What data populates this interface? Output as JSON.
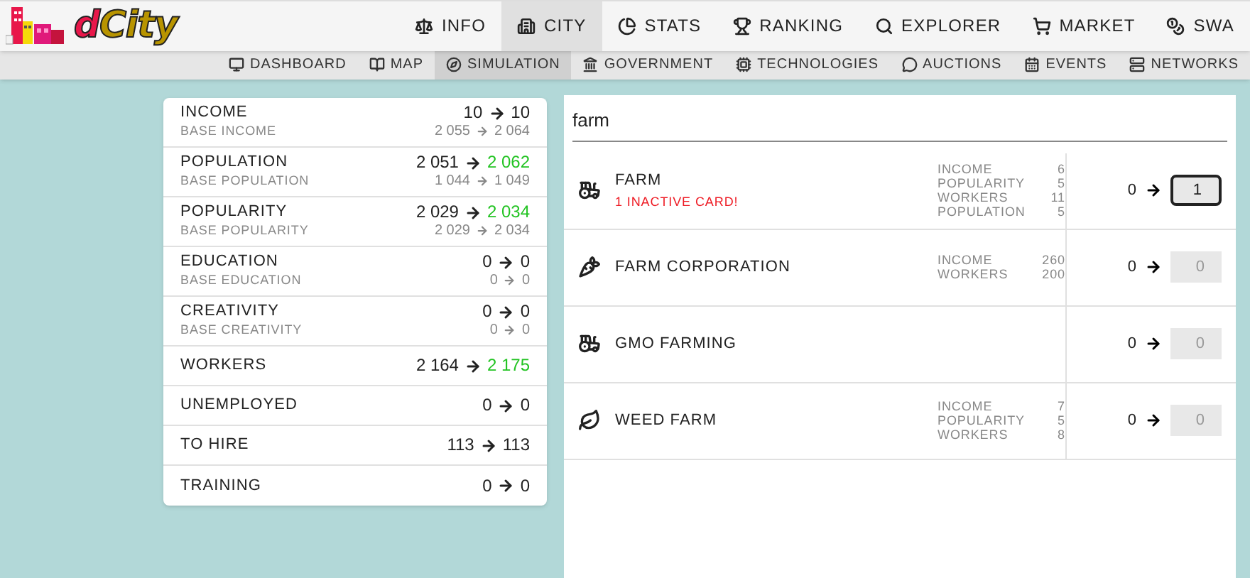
{
  "logo": {
    "prefix": "d",
    "name": "City"
  },
  "nav": [
    {
      "label": "INFO",
      "selected": false
    },
    {
      "label": "CITY",
      "selected": true
    },
    {
      "label": "STATS",
      "selected": false
    },
    {
      "label": "RANKING",
      "selected": false
    },
    {
      "label": "EXPLORER",
      "selected": false
    },
    {
      "label": "MARKET",
      "selected": false
    },
    {
      "label": "SWA",
      "selected": false
    }
  ],
  "subnav": [
    {
      "label": "DASHBOARD",
      "selected": false
    },
    {
      "label": "MAP",
      "selected": false
    },
    {
      "label": "SIMULATION",
      "selected": true
    },
    {
      "label": "GOVERNMENT",
      "selected": false
    },
    {
      "label": "TECHNOLOGIES",
      "selected": false
    },
    {
      "label": "AUCTIONS",
      "selected": false
    },
    {
      "label": "EVENTS",
      "selected": false
    },
    {
      "label": "NETWORKS",
      "selected": false
    }
  ],
  "summary": [
    {
      "label": "INCOME",
      "from": "10",
      "to": "10",
      "up": false,
      "base": {
        "label": "BASE INCOME",
        "from": "2 055",
        "to": "2 064"
      }
    },
    {
      "label": "POPULATION",
      "from": "2 051",
      "to": "2 062",
      "up": true,
      "base": {
        "label": "BASE POPULATION",
        "from": "1 044",
        "to": "1 049"
      }
    },
    {
      "label": "POPULARITY",
      "from": "2 029",
      "to": "2 034",
      "up": true,
      "base": {
        "label": "BASE POPULARITY",
        "from": "2 029",
        "to": "2 034"
      }
    },
    {
      "label": "EDUCATION",
      "from": "0",
      "to": "0",
      "up": false,
      "base": {
        "label": "BASE EDUCATION",
        "from": "0",
        "to": "0"
      }
    },
    {
      "label": "CREATIVITY",
      "from": "0",
      "to": "0",
      "up": false,
      "base": {
        "label": "BASE CREATIVITY",
        "from": "0",
        "to": "0"
      }
    },
    {
      "label": "WORKERS",
      "from": "2 164",
      "to": "2 175",
      "up": true
    },
    {
      "label": "UNEMPLOYED",
      "from": "0",
      "to": "0",
      "up": false
    },
    {
      "label": "TO HIRE",
      "from": "113",
      "to": "113",
      "up": false
    },
    {
      "label": "TRAINING",
      "from": "0",
      "to": "0",
      "up": false
    }
  ],
  "search": {
    "value": "farm"
  },
  "cards": [
    {
      "kind": "tractor",
      "name": "FARM",
      "warning": "1 INACTIVE CARD!",
      "stats": [
        {
          "label": "INCOME",
          "value": "6"
        },
        {
          "label": "POPULARITY",
          "value": "5"
        },
        {
          "label": "WORKERS",
          "value": "11"
        },
        {
          "label": "POPULATION",
          "value": "5"
        }
      ],
      "from": "0",
      "value": "1",
      "active": true
    },
    {
      "kind": "carrot",
      "name": "FARM CORPORATION",
      "stats": [
        {
          "label": "INCOME",
          "value": "260"
        },
        {
          "label": "WORKERS",
          "value": "200"
        }
      ],
      "from": "0",
      "value": "0",
      "active": false
    },
    {
      "kind": "tractor",
      "name": "GMO FARMING",
      "from": "0",
      "value": "0",
      "active": false
    },
    {
      "kind": "leaf",
      "name": "WEED FARM",
      "stats": [
        {
          "label": "INCOME",
          "value": "7"
        },
        {
          "label": "POPULARITY",
          "value": "5"
        },
        {
          "label": "WORKERS",
          "value": "8"
        }
      ],
      "from": "0",
      "value": "0",
      "active": false
    }
  ]
}
